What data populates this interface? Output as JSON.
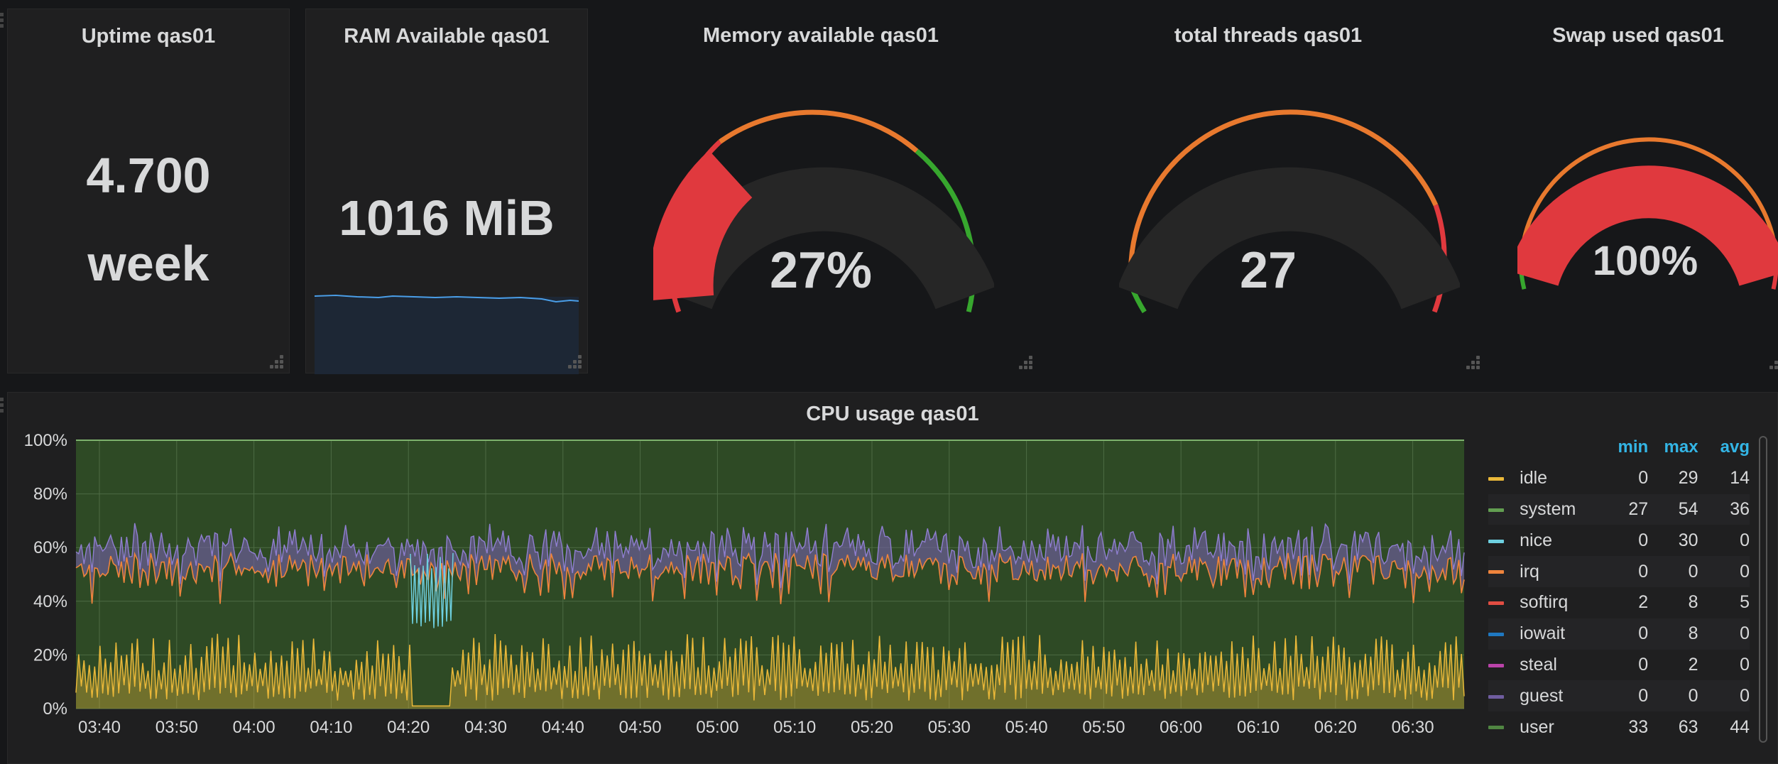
{
  "colors": {
    "background": "#161719",
    "panel": "#1f1f20",
    "red": "#e0393e",
    "orange": "#e8792e",
    "green": "#37a72e",
    "sparkline": "#4a9ee8",
    "legend_header": "#33b5e5"
  },
  "panels": {
    "uptime": {
      "title": "Uptime qas01",
      "value": "4.700",
      "unit": "week"
    },
    "ram": {
      "title": "RAM Available qas01",
      "value": "1016 MiB"
    },
    "memory": {
      "title": "Memory available qas01",
      "value": "27%",
      "gauge_fraction": 0.27
    },
    "threads": {
      "title": "total threads qas01",
      "value": "27"
    },
    "swap": {
      "title": "Swap used qas01",
      "value": "100%",
      "gauge_fraction": 1.0
    }
  },
  "cpu": {
    "title": "CPU usage qas01",
    "legend_headers": {
      "min": "min",
      "max": "max",
      "avg": "avg"
    },
    "legend": [
      {
        "name": "idle",
        "color": "#eab839",
        "min": "0",
        "max": "29",
        "avg": "14"
      },
      {
        "name": "system",
        "color": "#629e51",
        "min": "27",
        "max": "54",
        "avg": "36"
      },
      {
        "name": "nice",
        "color": "#6ed0e0",
        "min": "0",
        "max": "30",
        "avg": "0"
      },
      {
        "name": "irq",
        "color": "#ef843c",
        "min": "0",
        "max": "0",
        "avg": "0"
      },
      {
        "name": "softirq",
        "color": "#e24d42",
        "min": "2",
        "max": "8",
        "avg": "5"
      },
      {
        "name": "iowait",
        "color": "#1f78c1",
        "min": "0",
        "max": "8",
        "avg": "0"
      },
      {
        "name": "steal",
        "color": "#ba43a9",
        "min": "0",
        "max": "2",
        "avg": "0"
      },
      {
        "name": "guest",
        "color": "#705da0",
        "min": "0",
        "max": "0",
        "avg": "0"
      },
      {
        "name": "user",
        "color": "#508642",
        "min": "33",
        "max": "63",
        "avg": "44"
      }
    ]
  },
  "chart_data": {
    "type": "area",
    "title": "CPU usage qas01",
    "x": [
      "03:40",
      "03:50",
      "04:00",
      "04:10",
      "04:20",
      "04:30",
      "04:40",
      "04:50",
      "05:00",
      "05:10",
      "05:20",
      "05:30",
      "05:40",
      "05:50",
      "06:00",
      "06:10",
      "06:20",
      "06:30"
    ],
    "y_ticks": [
      "0%",
      "20%",
      "40%",
      "60%",
      "80%",
      "100%"
    ],
    "ylim": [
      0,
      100
    ],
    "stacked": true,
    "grid": true,
    "legend_position": "right",
    "series": [
      {
        "name": "idle",
        "approx_range": [
          0,
          29
        ],
        "avg": 14
      },
      {
        "name": "system",
        "approx_range": [
          27,
          54
        ],
        "avg": 36
      },
      {
        "name": "user",
        "approx_range": [
          33,
          63
        ],
        "avg": 44
      }
    ]
  }
}
